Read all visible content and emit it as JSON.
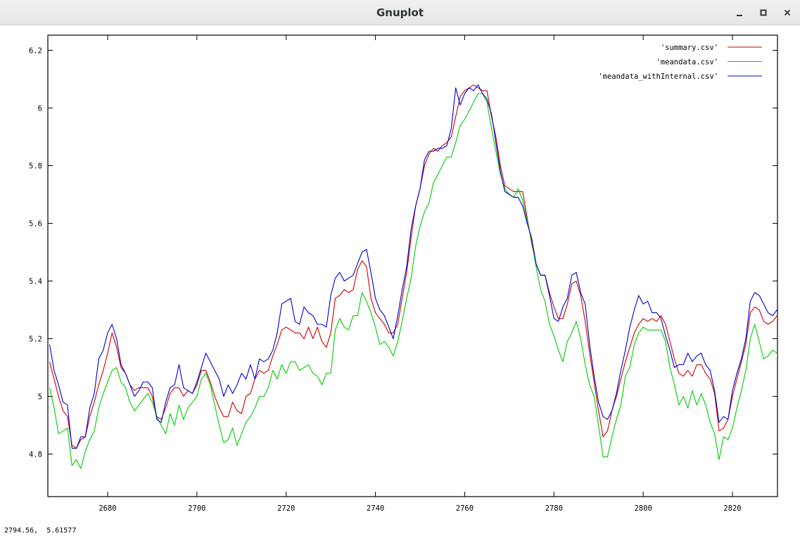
{
  "window": {
    "title": "Gnuplot",
    "minimize_icon": "minimize-icon",
    "maximize_icon": "maximize-icon",
    "close_icon": "close-icon"
  },
  "status": {
    "coordinates": "2794.56,  5.61577"
  },
  "chart_data": {
    "type": "line",
    "title": "",
    "xlabel": "",
    "ylabel": "",
    "xlim": [
      2667,
      2830
    ],
    "ylim": [
      4.7,
      6.23
    ],
    "xticks": [
      2680,
      2700,
      2720,
      2740,
      2760,
      2780,
      2800,
      2820
    ],
    "yticks": [
      4.8,
      5,
      5.2,
      5.4,
      5.6,
      5.8,
      6,
      6.2
    ],
    "ytick_labels": [
      "4.8",
      "5",
      "5.2",
      "5.4",
      "5.6",
      "5.8",
      "6",
      "6.2"
    ],
    "grid": false,
    "legend_position": "top-right",
    "x_start": 2667,
    "x_step": 1,
    "series": [
      {
        "name": "'summary.csv'",
        "color": "#cc0000",
        "values": [
          5.12,
          5.06,
          5.0,
          4.95,
          4.93,
          4.83,
          4.82,
          4.85,
          4.86,
          4.93,
          4.98,
          5.04,
          5.09,
          5.15,
          5.22,
          5.17,
          5.1,
          5.08,
          5.04,
          5.02,
          5.03,
          5.03,
          5.03,
          5.0,
          4.93,
          4.92,
          4.96,
          5.01,
          5.03,
          5.03,
          5.0,
          5.02,
          5.01,
          5.04,
          5.09,
          5.09,
          5.05,
          5.0,
          4.96,
          4.93,
          4.93,
          4.98,
          4.95,
          4.94,
          5.0,
          5.01,
          5.06,
          5.09,
          5.08,
          5.09,
          5.14,
          5.18,
          5.23,
          5.24,
          5.23,
          5.22,
          5.22,
          5.2,
          5.24,
          5.2,
          5.24,
          5.19,
          5.17,
          5.22,
          5.34,
          5.35,
          5.37,
          5.36,
          5.37,
          5.44,
          5.47,
          5.45,
          5.34,
          5.29,
          5.27,
          5.25,
          5.22,
          5.22,
          5.25,
          5.34,
          5.43,
          5.55,
          5.66,
          5.72,
          5.8,
          5.84,
          5.86,
          5.85,
          5.87,
          5.88,
          5.9,
          5.97,
          6.04,
          6.06,
          6.07,
          6.08,
          6.07,
          6.06,
          6.06,
          5.97,
          5.9,
          5.8,
          5.73,
          5.72,
          5.71,
          5.71,
          5.71,
          5.62,
          5.53,
          5.46,
          5.42,
          5.42,
          5.36,
          5.31,
          5.27,
          5.27,
          5.32,
          5.39,
          5.4,
          5.35,
          5.26,
          5.15,
          5.05,
          4.95,
          4.86,
          4.88,
          4.95,
          5.0,
          5.06,
          5.12,
          5.17,
          5.22,
          5.25,
          5.27,
          5.26,
          5.27,
          5.26,
          5.28,
          5.25,
          5.19,
          5.13,
          5.08,
          5.07,
          5.09,
          5.07,
          5.11,
          5.11,
          5.08,
          5.06,
          5.01,
          4.88,
          4.89,
          4.92,
          5.0,
          5.06,
          5.12,
          5.18,
          5.29,
          5.31,
          5.3,
          5.26,
          5.25,
          5.26,
          5.28,
          5.22,
          5.21,
          5.19,
          5.19,
          5.24
        ]
      },
      {
        "name": "'meandata.csv'",
        "color": "#00cc00",
        "values": [
          5.03,
          4.96,
          4.87,
          4.88,
          4.89,
          4.76,
          4.78,
          4.75,
          4.81,
          4.85,
          4.88,
          4.96,
          5.01,
          5.05,
          5.09,
          5.1,
          5.05,
          5.03,
          4.98,
          4.95,
          4.97,
          4.99,
          5.01,
          4.98,
          4.93,
          4.9,
          4.87,
          4.94,
          4.9,
          4.97,
          4.92,
          4.96,
          4.98,
          5.0,
          5.06,
          5.08,
          5.04,
          4.97,
          4.9,
          4.84,
          4.85,
          4.89,
          4.83,
          4.87,
          4.91,
          4.93,
          4.96,
          5.0,
          5.0,
          5.03,
          5.09,
          5.06,
          5.11,
          5.08,
          5.12,
          5.12,
          5.09,
          5.1,
          5.11,
          5.08,
          5.07,
          5.04,
          5.08,
          5.08,
          5.23,
          5.27,
          5.24,
          5.23,
          5.28,
          5.28,
          5.36,
          5.33,
          5.29,
          5.24,
          5.18,
          5.19,
          5.17,
          5.14,
          5.19,
          5.26,
          5.34,
          5.41,
          5.52,
          5.59,
          5.64,
          5.67,
          5.74,
          5.77,
          5.8,
          5.83,
          5.83,
          5.88,
          5.94,
          5.96,
          5.99,
          6.02,
          6.05,
          6.05,
          6.02,
          5.93,
          5.85,
          5.77,
          5.72,
          5.7,
          5.69,
          5.72,
          5.68,
          5.61,
          5.54,
          5.45,
          5.37,
          5.33,
          5.25,
          5.21,
          5.16,
          5.12,
          5.19,
          5.22,
          5.26,
          5.2,
          5.11,
          5.04,
          5.0,
          4.9,
          4.79,
          4.79,
          4.86,
          4.92,
          4.97,
          5.07,
          5.1,
          5.18,
          5.22,
          5.24,
          5.23,
          5.23,
          5.23,
          5.23,
          5.19,
          5.1,
          5.04,
          4.97,
          5.0,
          4.96,
          5.02,
          4.97,
          5.01,
          4.97,
          4.91,
          4.87,
          4.78,
          4.86,
          4.85,
          4.89,
          4.96,
          5.02,
          5.09,
          5.2,
          5.25,
          5.19,
          5.13,
          5.14,
          5.16,
          5.15,
          5.06,
          5.13,
          5.05,
          5.09
        ]
      },
      {
        "name": "'meandata_withInternal.csv'",
        "color": "#0000cc",
        "values": [
          5.18,
          5.09,
          5.04,
          4.98,
          4.97,
          4.82,
          4.82,
          4.86,
          4.86,
          4.96,
          5.01,
          5.13,
          5.16,
          5.22,
          5.25,
          5.2,
          5.11,
          5.08,
          5.04,
          5.0,
          5.02,
          5.05,
          5.05,
          5.03,
          4.92,
          4.91,
          4.98,
          5.03,
          5.04,
          5.11,
          5.03,
          5.02,
          5.01,
          5.05,
          5.1,
          5.15,
          5.12,
          5.09,
          5.06,
          5.0,
          5.04,
          5.01,
          5.04,
          5.08,
          5.06,
          5.11,
          5.06,
          5.13,
          5.12,
          5.13,
          5.16,
          5.22,
          5.32,
          5.33,
          5.34,
          5.26,
          5.25,
          5.31,
          5.29,
          5.28,
          5.25,
          5.25,
          5.24,
          5.35,
          5.41,
          5.43,
          5.4,
          5.41,
          5.42,
          5.46,
          5.5,
          5.51,
          5.43,
          5.34,
          5.3,
          5.28,
          5.24,
          5.2,
          5.28,
          5.37,
          5.45,
          5.58,
          5.66,
          5.72,
          5.82,
          5.85,
          5.85,
          5.86,
          5.86,
          5.87,
          5.93,
          6.07,
          6.01,
          6.05,
          6.07,
          6.06,
          6.08,
          6.05,
          6.03,
          5.98,
          5.88,
          5.78,
          5.71,
          5.7,
          5.69,
          5.69,
          5.66,
          5.6,
          5.55,
          5.46,
          5.42,
          5.42,
          5.35,
          5.27,
          5.26,
          5.31,
          5.34,
          5.42,
          5.43,
          5.36,
          5.32,
          5.18,
          5.07,
          4.98,
          4.93,
          4.92,
          4.95,
          5.01,
          5.09,
          5.16,
          5.24,
          5.3,
          5.35,
          5.32,
          5.33,
          5.29,
          5.29,
          5.27,
          5.21,
          5.16,
          5.1,
          5.11,
          5.11,
          5.15,
          5.12,
          5.14,
          5.15,
          5.11,
          5.09,
          5.02,
          4.91,
          4.93,
          4.92,
          5.02,
          5.08,
          5.13,
          5.2,
          5.33,
          5.36,
          5.35,
          5.32,
          5.29,
          5.28,
          5.3,
          5.24,
          5.24,
          5.21,
          5.21,
          5.26
        ]
      }
    ]
  }
}
